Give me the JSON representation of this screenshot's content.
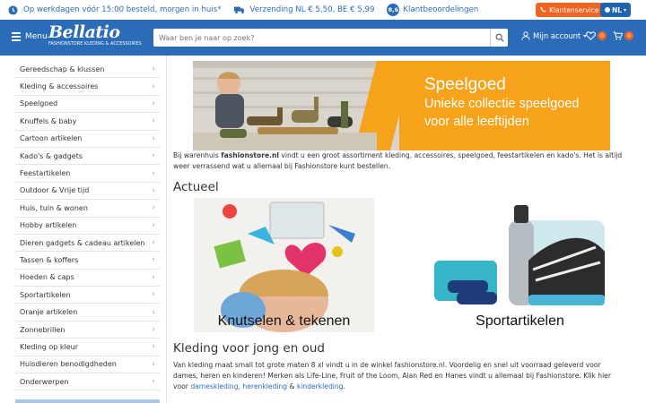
{
  "topbar": {
    "usp1": "Op werkdagen vóór 15:00 besteld, morgen in huis*",
    "usp2": "Verzending NL € 5,50, BE € 5,99",
    "rating": "8,6",
    "usp3": "Klantbeoordelingen",
    "service": "Klantenservice",
    "lang": "NL"
  },
  "header": {
    "menu_label": "Menu",
    "logo_name": "Bellatio",
    "logo_sub": "FASHIONSTORE KLEDING & ACCESSOIRES",
    "search_placeholder": "Waar ben je naar op zoek?",
    "account_label": "Mijn account",
    "wishlist_count": "0",
    "cart_count": "0"
  },
  "sidebar": {
    "items": [
      {
        "label": "Gereedschap & klussen"
      },
      {
        "label": "Kleding & accessoires"
      },
      {
        "label": "Speelgoed"
      },
      {
        "label": "Knuffels & baby"
      },
      {
        "label": "Cartoon artikelen"
      },
      {
        "label": "Kado's & gadgets"
      },
      {
        "label": "Feestartikelen"
      },
      {
        "label": "Outdoor & Vrije tijd"
      },
      {
        "label": "Huis, tuin & wonen"
      },
      {
        "label": "Hobby artikelen"
      },
      {
        "label": "Dieren gadgets & cadeau artikelen"
      },
      {
        "label": "Tassen & koffers"
      },
      {
        "label": "Hoeden & caps"
      },
      {
        "label": "Sportartikelen"
      },
      {
        "label": "Oranje artikelen"
      },
      {
        "label": "Zonnebrillen"
      },
      {
        "label": "Kleding op kleur"
      },
      {
        "label": "Huisdieren benodigdheden"
      },
      {
        "label": "Onderwerpen"
      }
    ]
  },
  "banner": {
    "title": "Speelgoed",
    "line1": "Unieke collectie speelgoed",
    "line2": "voor alle leeftijden"
  },
  "intro": {
    "pre": "Bij warenhuis ",
    "brand": "fashionstore.nl",
    "post": " vindt u een groot assortiment kleding, accessoires, speelgoed, feestartikelen en kado's. Het is altijd weer verrassend wat u allemaal bij Fashionstore kunt bestellen."
  },
  "actueel": {
    "heading": "Actueel",
    "tile1": "Knutselen & tekenen",
    "tile2": "Sportartikelen"
  },
  "kleding": {
    "heading": "Kleding voor jong en oud",
    "text": "Van kleding maat small tot grote maten 8 xl vindt u in de winkel fashionstore.nl. Voordelig en snel uit voorraad geleverd voor dames, heren en kinderen! Merken als Life-Line, Fruit of the Loom, Alan Red en Hanes vindt u allemaal bij Fashionstore. Klik hier voor ",
    "link1": "dameskleding",
    "sep1": ",",
    "link2": "herenkleding",
    "sep2": " & ",
    "link3": "kinderkleding",
    "end": "."
  },
  "colors": {
    "brand_blue": "#2a6cb8",
    "accent_orange": "#f26322",
    "banner_orange": "#f7a21b"
  }
}
